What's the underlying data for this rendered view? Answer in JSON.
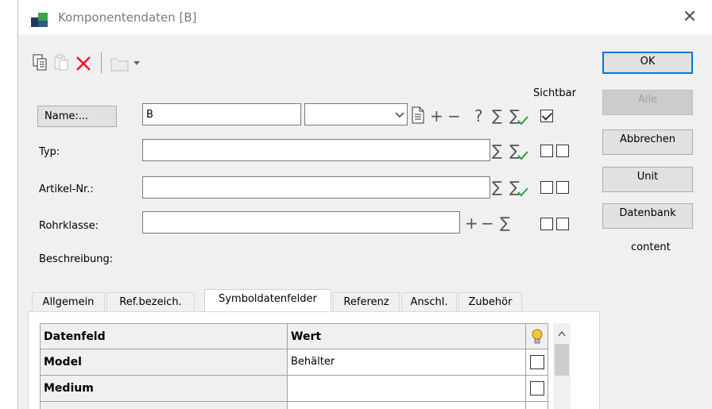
{
  "window": {
    "title": "Komponentendaten [B]",
    "close_glyph": "✕"
  },
  "toolbar": {
    "icons": [
      "copy-icon",
      "paste-icon",
      "delete-icon",
      "folder-icon",
      "dropdown-icon"
    ]
  },
  "buttons": {
    "ok": "OK",
    "alle": "Alle",
    "abbrechen": "Abbrechen",
    "unit": "Unit",
    "datenbank": "Datenbank",
    "content": "content"
  },
  "form": {
    "sichtbar_label": "Sichtbar",
    "name_button": "Name:...",
    "name_value": "B",
    "name_combo_value": "",
    "typ_label": "Typ:",
    "typ_value": "",
    "artikel_label": "Artikel-Nr.:",
    "artikel_value": "",
    "rohrklasse_label": "Rohrklasse:",
    "rohrklasse_value": "",
    "beschreibung_label": "Beschreibung:",
    "symbols": {
      "plus": "+",
      "minus": "−",
      "question": "?",
      "sigma": "∑"
    },
    "name_sichtbar_checked": true
  },
  "tabs": [
    {
      "label": "Allgemein",
      "active": false
    },
    {
      "label": "Ref.bezeich.",
      "active": false
    },
    {
      "label": "Symboldatenfelder",
      "active": true
    },
    {
      "label": "Referenz",
      "active": false
    },
    {
      "label": "Anschl.",
      "active": false
    },
    {
      "label": "Zubehör",
      "active": false
    }
  ],
  "grid": {
    "columns": [
      "Datenfeld",
      "Wert"
    ],
    "rows": [
      {
        "field": "Model",
        "value": "Behälter",
        "checked": false
      },
      {
        "field": "Medium",
        "value": "",
        "checked": false
      }
    ]
  },
  "colors": {
    "accent": "#0078d7",
    "green_check": "#2e9e3e",
    "delete_red": "#e81123"
  }
}
